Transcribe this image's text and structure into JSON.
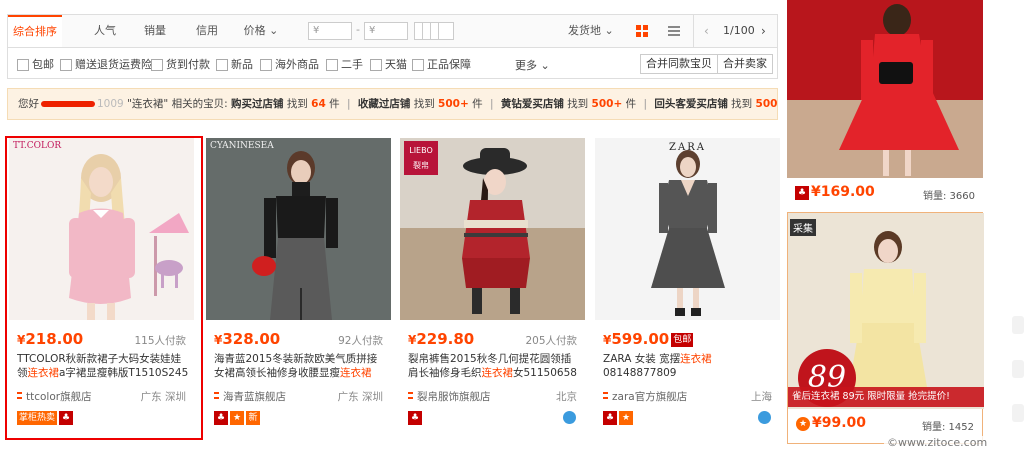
{
  "sort": {
    "tabs": [
      "综合排序",
      "人气",
      "销量",
      "信用",
      "价格"
    ],
    "price_from_placeholder": "¥",
    "price_to_placeholder": "¥",
    "dash": "-",
    "ship_from": "发货地",
    "page_indicator": "1/100"
  },
  "filters": {
    "options": [
      "包邮",
      "赠送退货运费险",
      "货到付款",
      "新品",
      "海外商品",
      "二手",
      "天猫",
      "正品保障"
    ],
    "more": "更多",
    "merge_same": "合并同款宝贝",
    "merge_seller": "合并卖家"
  },
  "notice": {
    "hello": "您好",
    "name_suffix": "1009",
    "query_text": "\"连衣裙\" 相关的宝贝:",
    "p1_label": "购买过店铺",
    "p1_pre": "找到",
    "p1_num": "64",
    "p1_unit": "件",
    "p2_label": "收藏过店铺",
    "p2_pre": "找到",
    "p2_num": "500+",
    "p2_unit": "件",
    "p3_label": "黄钻爱买店铺",
    "p3_pre": "找到",
    "p3_num": "500+",
    "p3_unit": "件",
    "p4_label": "回头客爱买店铺",
    "p4_pre": "找到",
    "p4_num": "500+",
    "p4_unit": "件",
    "sep": "|"
  },
  "products": [
    {
      "brand": "TT.COLOR",
      "currency": "¥",
      "price": "218.00",
      "sold": "115人付款",
      "title_pre": "TTCOLOR秋新款裙子大码女装娃娃领",
      "title_kw": "连衣裙",
      "title_post": "a字裙显瘦韩版T1510S245",
      "shop": "ttcolor旗舰店",
      "location": "广东 深圳",
      "badge": "掌柜热卖"
    },
    {
      "brand": "CYANINESEA",
      "currency": "¥",
      "price": "328.00",
      "sold": "92人付款",
      "title_pre": "海青蓝2015冬装新款欧美气质拼接女裙高领长袖修身收腰显瘦",
      "title_kw": "连衣裙",
      "title_post": "",
      "shop": "海青蓝旗舰店",
      "location": "广东 深圳",
      "badge": "新"
    },
    {
      "brand": "LIEBO 裂帛",
      "currency": "¥",
      "price": "229.80",
      "sold": "205人付款",
      "title_pre": "裂帛裤售2015秋冬几何提花圆领插肩长袖修身毛织",
      "title_kw": "连衣裙",
      "title_post": "女51150658",
      "shop": "裂帛服饰旗舰店",
      "location": "北京",
      "badge": ""
    },
    {
      "brand": "ZARA",
      "currency": "¥",
      "price": "599.00",
      "sold": "",
      "tag": "包邮",
      "title_pre": "ZARA 女装 宽摆",
      "title_kw": "连衣裙",
      "title_post": " 08148877809",
      "shop": "zara官方旗舰店",
      "location": "上海",
      "badge": ""
    }
  ],
  "sidebar": [
    {
      "currency": "¥",
      "price": "169.00",
      "sold": "销量: 3660"
    },
    {
      "tag": "采集",
      "big_price": "89",
      "promo": "雀后连衣裙 89元 限时限量 抢完提价!",
      "currency": "¥",
      "price": "99.00",
      "sold": "销量: 1452"
    }
  ],
  "watermark": "©www.zitoce.com",
  "colors": {
    "accent": "#ff4400",
    "selected_border": "#ee0000"
  }
}
